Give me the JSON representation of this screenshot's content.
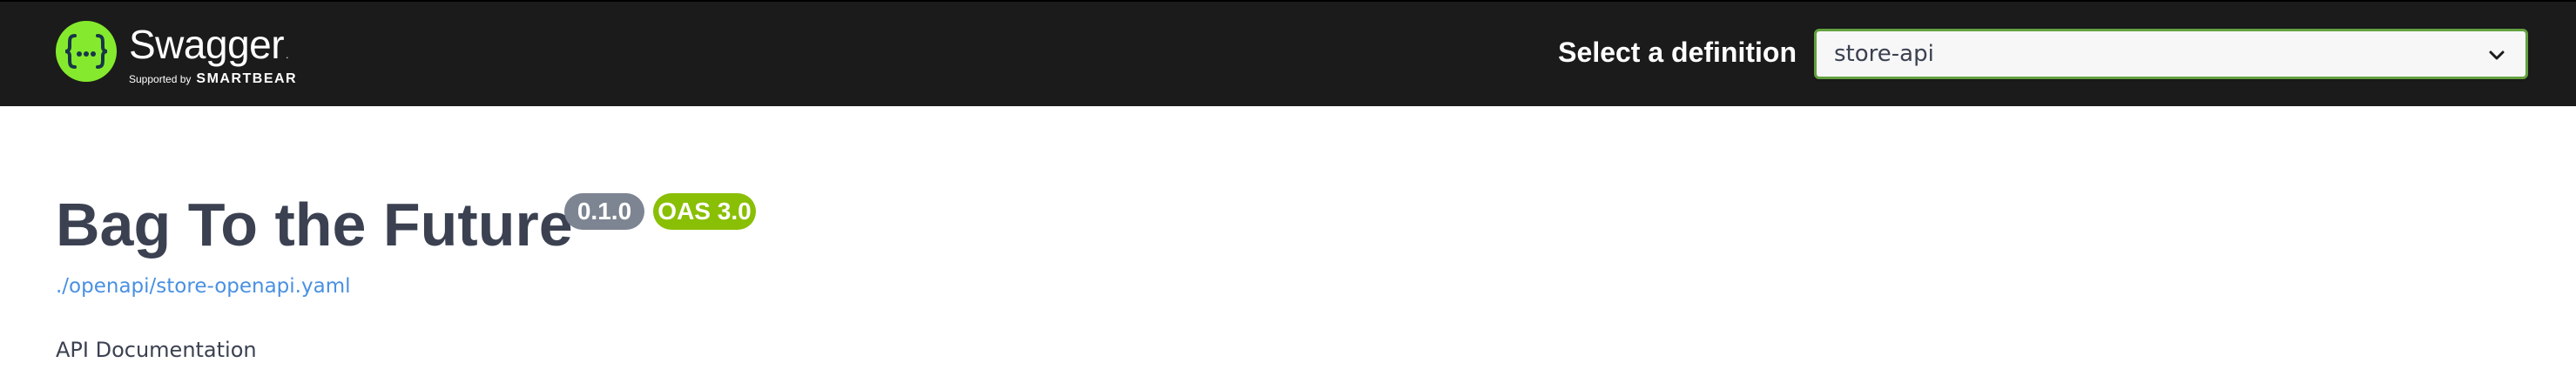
{
  "header": {
    "logo_text": "Swagger",
    "logo_tm": ".",
    "supported_by": "Supported by",
    "brand": "SMARTBEAR",
    "definition_label": "Select a definition",
    "definition_value": "store-api"
  },
  "info": {
    "title": "Bag To the Future",
    "version": "0.1.0",
    "oas": "OAS 3.0",
    "spec_url": "./openapi/store-openapi.yaml",
    "description": "API Documentation"
  },
  "colors": {
    "topbar_bg": "#1b1b1b",
    "logo_green": "#85ea2d",
    "select_border": "#62a03f",
    "version_badge": "#7d8492",
    "oas_badge": "#89bf04",
    "link": "#4990e2",
    "text": "#3b4151"
  },
  "icons": {
    "logo": "swagger-braces-icon",
    "select": "chevron-down-icon"
  }
}
